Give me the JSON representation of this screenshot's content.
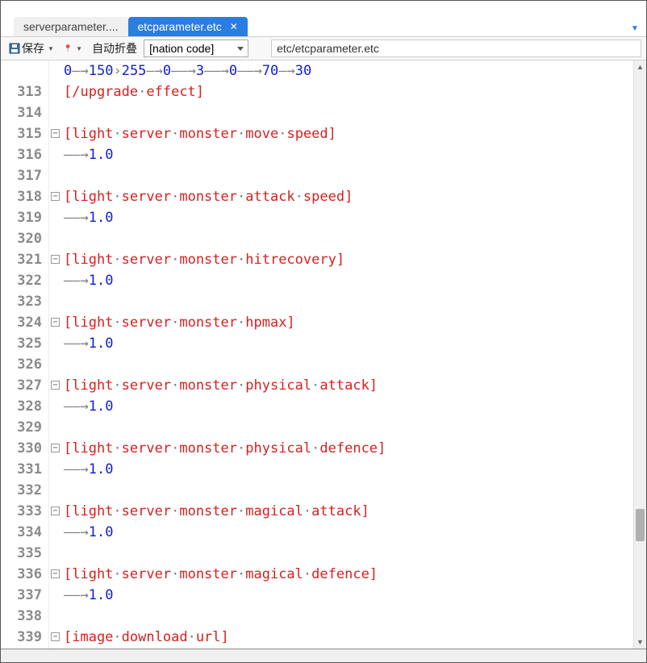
{
  "tabs": {
    "inactive_label": "serverparameter....",
    "active_label": "etcparameter.etc"
  },
  "toolbar": {
    "save_label": "保存",
    "auto_fold_label": "自动折叠",
    "combo_value": "[nation code]",
    "path_value": "etc/etcparameter.etc"
  },
  "lines": [
    {
      "num": "",
      "fold": false,
      "type": "nums",
      "tokens": [
        "0",
        "150",
        "255",
        "0",
        "3",
        "0",
        "70",
        "30"
      ]
    },
    {
      "num": "313",
      "fold": false,
      "type": "tag",
      "text": "[/upgrade",
      "parts": [
        "effect]"
      ]
    },
    {
      "num": "314",
      "fold": false,
      "type": "blank"
    },
    {
      "num": "315",
      "fold": true,
      "type": "tag",
      "text": "[light",
      "parts": [
        "server",
        "monster",
        "move",
        "speed]"
      ]
    },
    {
      "num": "316",
      "fold": false,
      "type": "val",
      "value": "1.0"
    },
    {
      "num": "317",
      "fold": false,
      "type": "blank"
    },
    {
      "num": "318",
      "fold": true,
      "type": "tag",
      "text": "[light",
      "parts": [
        "server",
        "monster",
        "attack",
        "speed]"
      ]
    },
    {
      "num": "319",
      "fold": false,
      "type": "val",
      "value": "1.0"
    },
    {
      "num": "320",
      "fold": false,
      "type": "blank"
    },
    {
      "num": "321",
      "fold": true,
      "type": "tag",
      "text": "[light",
      "parts": [
        "server",
        "monster",
        "hitrecovery]"
      ]
    },
    {
      "num": "322",
      "fold": false,
      "type": "val",
      "value": "1.0"
    },
    {
      "num": "323",
      "fold": false,
      "type": "blank"
    },
    {
      "num": "324",
      "fold": true,
      "type": "tag",
      "text": "[light",
      "parts": [
        "server",
        "monster",
        "hpmax]"
      ]
    },
    {
      "num": "325",
      "fold": false,
      "type": "val",
      "value": "1.0"
    },
    {
      "num": "326",
      "fold": false,
      "type": "blank"
    },
    {
      "num": "327",
      "fold": true,
      "type": "tag",
      "text": "[light",
      "parts": [
        "server",
        "monster",
        "physical",
        "attack]"
      ]
    },
    {
      "num": "328",
      "fold": false,
      "type": "val",
      "value": "1.0"
    },
    {
      "num": "329",
      "fold": false,
      "type": "blank"
    },
    {
      "num": "330",
      "fold": true,
      "type": "tag",
      "text": "[light",
      "parts": [
        "server",
        "monster",
        "physical",
        "defence]"
      ]
    },
    {
      "num": "331",
      "fold": false,
      "type": "val",
      "value": "1.0"
    },
    {
      "num": "332",
      "fold": false,
      "type": "blank"
    },
    {
      "num": "333",
      "fold": true,
      "type": "tag",
      "text": "[light",
      "parts": [
        "server",
        "monster",
        "magical",
        "attack]"
      ]
    },
    {
      "num": "334",
      "fold": false,
      "type": "val",
      "value": "1.0"
    },
    {
      "num": "335",
      "fold": false,
      "type": "blank"
    },
    {
      "num": "336",
      "fold": true,
      "type": "tag",
      "text": "[light",
      "parts": [
        "server",
        "monster",
        "magical",
        "defence]"
      ]
    },
    {
      "num": "337",
      "fold": false,
      "type": "val",
      "value": "1.0"
    },
    {
      "num": "338",
      "fold": false,
      "type": "blank"
    },
    {
      "num": "339",
      "fold": true,
      "type": "tag",
      "text": "[image",
      "parts": [
        "download",
        "url]"
      ]
    }
  ]
}
